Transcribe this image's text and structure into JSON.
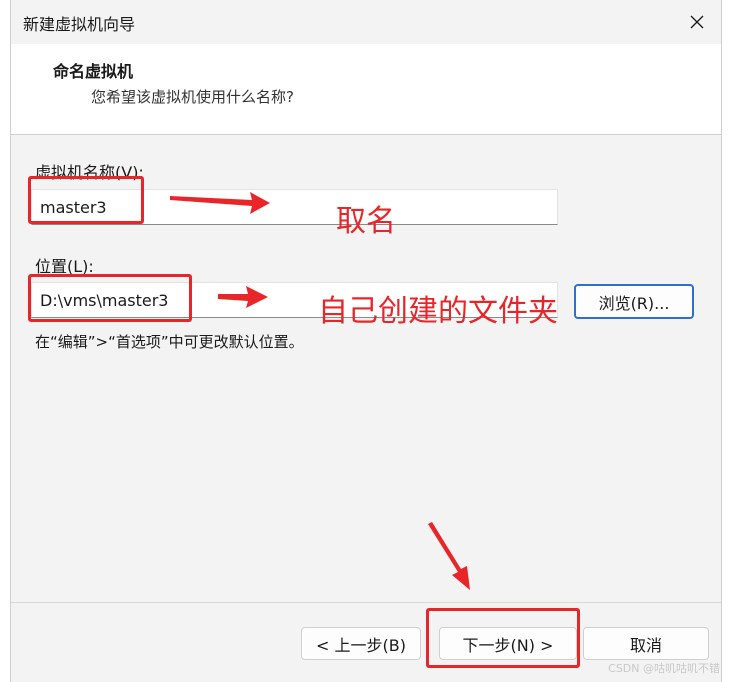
{
  "window": {
    "title": "新建虚拟机向导"
  },
  "header": {
    "title": "命名虚拟机",
    "subtitle": "您希望该虚拟机使用什么名称?"
  },
  "form": {
    "name_label": "虚拟机名称(V):",
    "name_value": "master3",
    "location_label": "位置(L):",
    "location_value": "D:\\vms\\master3",
    "browse_label": "浏览(R)...",
    "hint": "在“编辑”>“首选项”中可更改默认位置。"
  },
  "footer": {
    "back_label": "< 上一步(B)",
    "next_label": "下一步(N) >",
    "cancel_label": "取消"
  },
  "annotations": {
    "name_note": "取名",
    "location_note": "自己创建的文件夹",
    "color": "#e8262a"
  },
  "watermark": "CSDN @咕叽咕叽不错",
  "icons": {
    "close": "close-icon"
  }
}
